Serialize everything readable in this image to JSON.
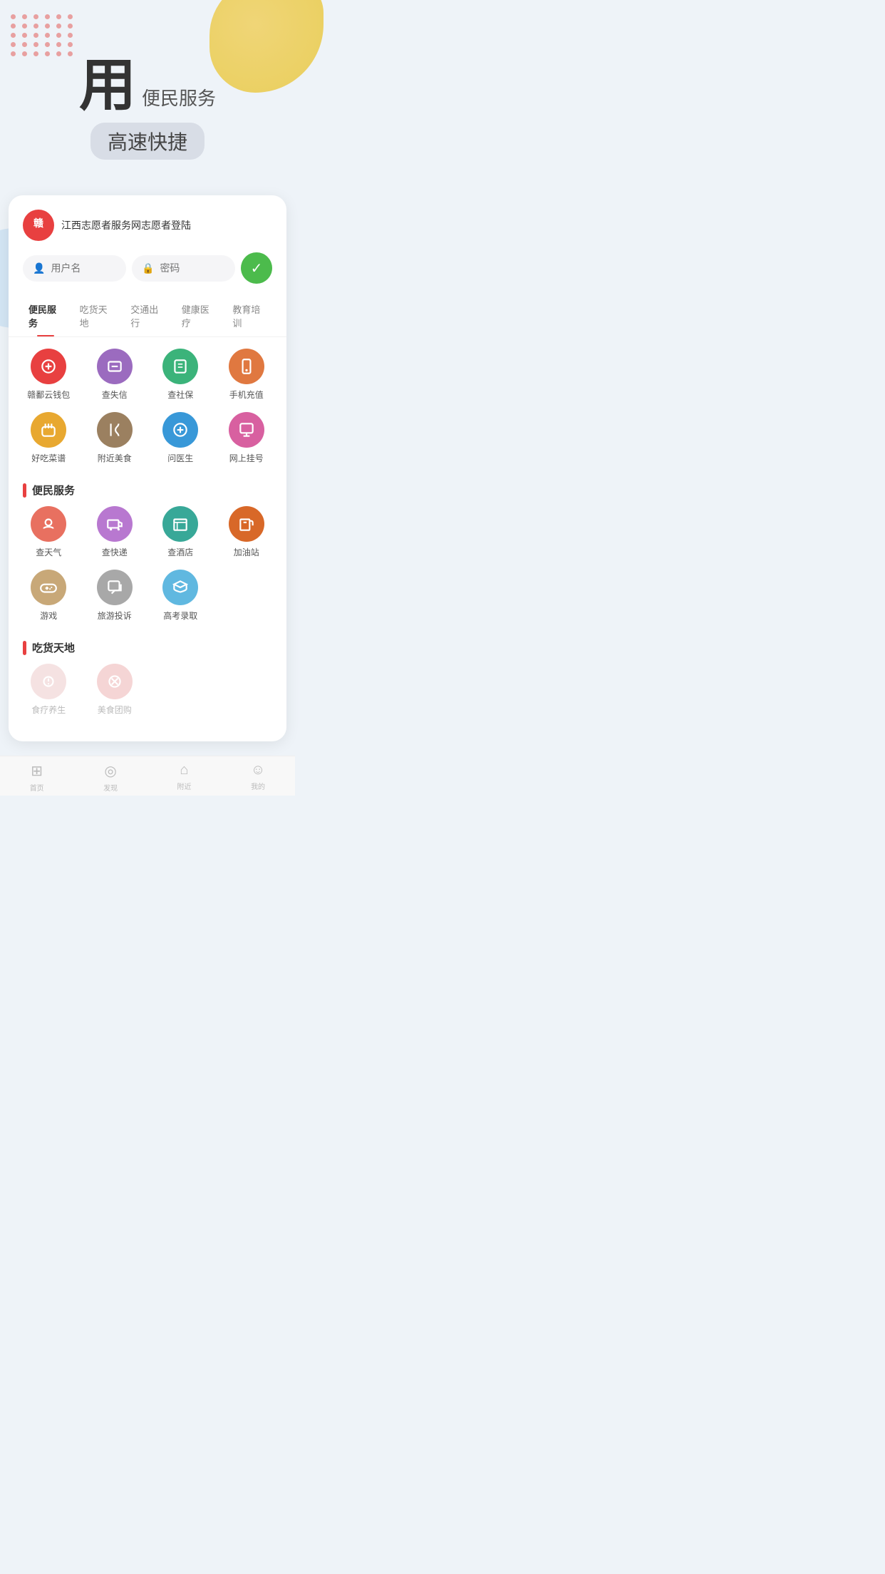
{
  "hero": {
    "big_char": "用",
    "sub_text": "便民服务",
    "tagline": "高速快捷"
  },
  "login": {
    "logo_text": "赣",
    "title": "江西志愿者服务网志愿者登陆",
    "username_placeholder": "用户名",
    "password_placeholder": "密码"
  },
  "tabs": [
    {
      "label": "便民服务",
      "active": true
    },
    {
      "label": "吃货天地",
      "active": false
    },
    {
      "label": "交通出行",
      "active": false
    },
    {
      "label": "健康医疗",
      "active": false
    },
    {
      "label": "教育培训",
      "active": false
    }
  ],
  "grid1": [
    {
      "label": "赣鄱云钱包",
      "color": "c-red"
    },
    {
      "label": "查失信",
      "color": "c-purple"
    },
    {
      "label": "查社保",
      "color": "c-green"
    },
    {
      "label": "手机充值",
      "color": "c-orange"
    },
    {
      "label": "好吃菜谱",
      "color": "c-yellow"
    },
    {
      "label": "附近美食",
      "color": "c-brown"
    },
    {
      "label": "问医生",
      "color": "c-blue"
    },
    {
      "label": "网上挂号",
      "color": "c-pink"
    }
  ],
  "section1": {
    "title": "便民服务"
  },
  "grid2": [
    {
      "label": "查天气",
      "color": "c-salmon"
    },
    {
      "label": "查快递",
      "color": "c-lightpurple"
    },
    {
      "label": "查酒店",
      "color": "c-teal"
    },
    {
      "label": "加油站",
      "color": "c-darkorange"
    },
    {
      "label": "游戏",
      "color": "c-tan"
    },
    {
      "label": "旅游投诉",
      "color": "c-gray"
    },
    {
      "label": "高考录取",
      "color": "c-lightblue"
    }
  ],
  "section2": {
    "title": "吃货天地"
  },
  "grid3": [
    {
      "label": "食疗养生",
      "color": "c-lightpink",
      "faded": true
    },
    {
      "label": "美食团购",
      "color": "c-rose",
      "faded": true
    }
  ],
  "bottom_nav": [
    {
      "label": "首页",
      "icon": "⊞"
    },
    {
      "label": "发现",
      "icon": "◎"
    },
    {
      "label": "附近",
      "icon": "⌂"
    },
    {
      "label": "我的",
      "icon": "☺"
    }
  ]
}
